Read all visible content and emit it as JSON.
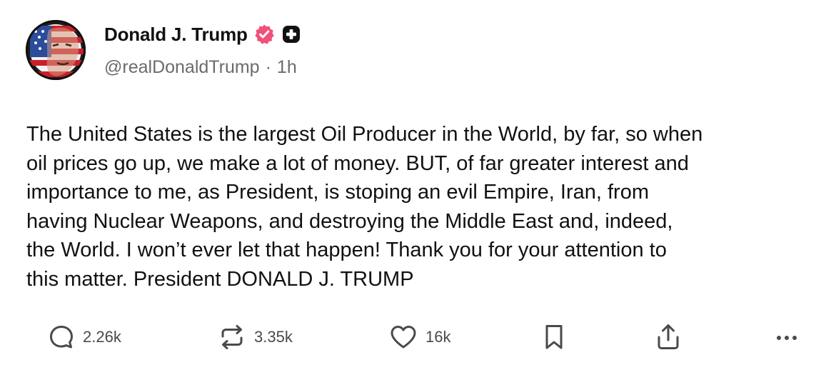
{
  "author": {
    "display_name": "Donald J. Trump",
    "handle": "@realDonaldTrump",
    "separator": "·",
    "time_ago": "1h",
    "avatar_icon": "flag-portrait-avatar",
    "verified_badge_color": "#f0507a",
    "secondary_badge_color": "#111111"
  },
  "post": {
    "text_lines": [
      "The United States is the largest Oil Producer in the World, by far, so when",
      "oil prices go up, we make a lot of money. BUT, of far greater interest and",
      "importance to me, as President, is stoping an evil Empire, Iran, from",
      "having Nuclear Weapons, and destroying the Middle East and, indeed,",
      "the World. I won’t ever let that happen! Thank you for your attention to",
      "this matter. President DONALD J. TRUMP"
    ]
  },
  "actions": {
    "reply": {
      "icon": "comment-icon",
      "count": "2.26k"
    },
    "repost": {
      "icon": "repost-icon",
      "count": "3.35k"
    },
    "like": {
      "icon": "heart-icon",
      "count": "16k"
    },
    "bookmark": {
      "icon": "bookmark-icon"
    },
    "share": {
      "icon": "share-icon"
    },
    "more": {
      "icon": "more-dots-icon"
    }
  },
  "colors": {
    "text": "#111111",
    "muted": "#6b6b6b",
    "icon": "#4a4a4a"
  }
}
